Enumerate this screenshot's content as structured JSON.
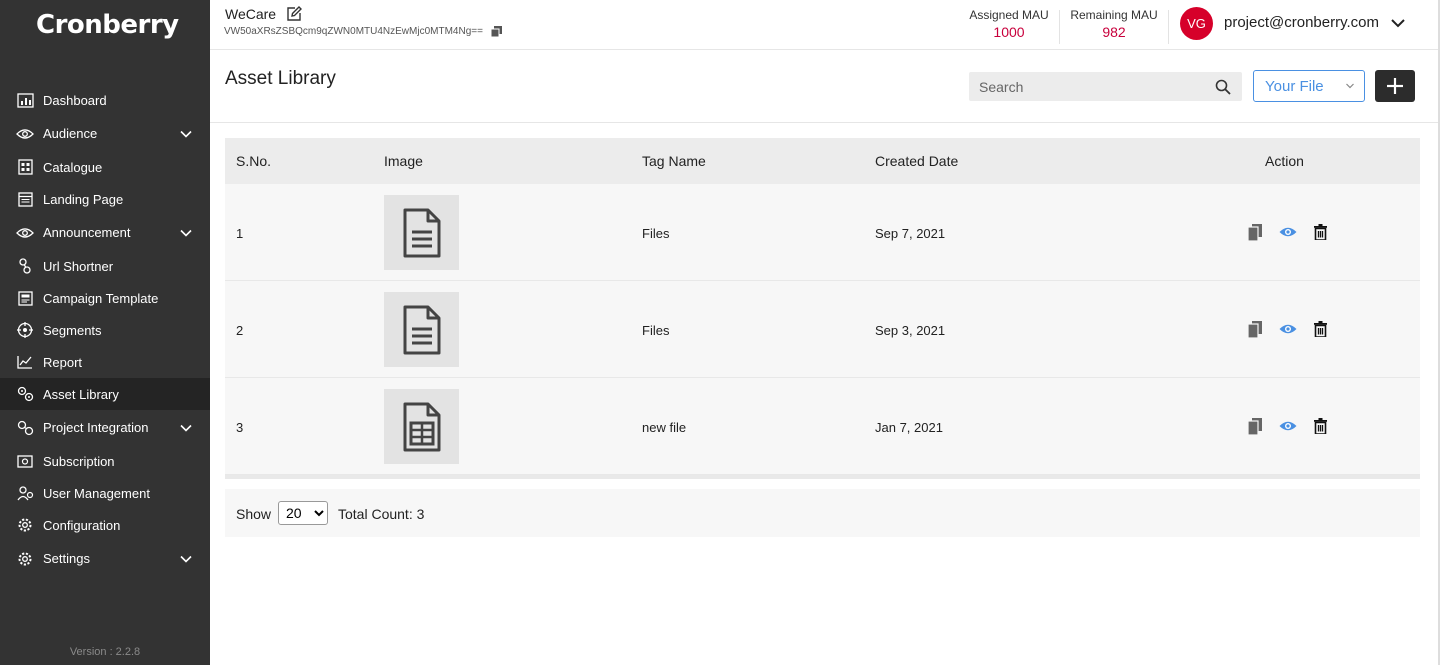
{
  "brand": {
    "logo_text": "Cronberry",
    "version": "Version : 2.2.8"
  },
  "sidebar": {
    "items": [
      {
        "label": "Dashboard",
        "icon": "dashboard-icon",
        "expandable": false
      },
      {
        "label": "Audience",
        "icon": "eye-icon",
        "expandable": true
      },
      {
        "label": "Catalogue",
        "icon": "catalogue-icon",
        "expandable": false
      },
      {
        "label": "Landing Page",
        "icon": "landing-page-icon",
        "expandable": false
      },
      {
        "label": "Announcement",
        "icon": "eye-icon",
        "expandable": true
      },
      {
        "label": "Url Shortner",
        "icon": "link-icon",
        "expandable": false
      },
      {
        "label": "Campaign Template",
        "icon": "template-icon",
        "expandable": false
      },
      {
        "label": "Segments",
        "icon": "segments-icon",
        "expandable": false
      },
      {
        "label": "Report",
        "icon": "report-icon",
        "expandable": false
      },
      {
        "label": "Asset Library",
        "icon": "asset-library-icon",
        "expandable": false,
        "active": true
      },
      {
        "label": "Project Integration",
        "icon": "integration-icon",
        "expandable": true
      },
      {
        "label": "Subscription",
        "icon": "subscription-icon",
        "expandable": false
      },
      {
        "label": "User Management",
        "icon": "user-management-icon",
        "expandable": false
      },
      {
        "label": "Configuration",
        "icon": "gear-icon",
        "expandable": false
      },
      {
        "label": "Settings",
        "icon": "gear-icon",
        "expandable": true
      }
    ]
  },
  "header": {
    "project_name": "WeCare",
    "project_key": "VW50aXRsZSBQcm9qZWN0MTU4NzEwMjc0MTM4Ng==",
    "assigned_mau_label": "Assigned MAU",
    "assigned_mau_value": "1000",
    "remaining_mau_label": "Remaining MAU",
    "remaining_mau_value": "982",
    "avatar_initials": "VG",
    "user_email": "project@cronberry.com"
  },
  "page": {
    "title": "Asset Library",
    "search_placeholder": "Search",
    "filter_value": "Your File"
  },
  "table": {
    "columns": {
      "sno": "S.No.",
      "image": "Image",
      "tag": "Tag Name",
      "date": "Created Date",
      "action": "Action"
    },
    "rows": [
      {
        "sno": "1",
        "tag": "Files",
        "date": "Sep 7, 2021",
        "thumb_icon": "document-icon"
      },
      {
        "sno": "2",
        "tag": "Files",
        "date": "Sep 3, 2021",
        "thumb_icon": "document-icon"
      },
      {
        "sno": "3",
        "tag": "new file",
        "date": "Jan 7, 2021",
        "thumb_icon": "spreadsheet-icon"
      }
    ]
  },
  "pager": {
    "show_label": "Show",
    "page_size": "20",
    "page_size_options": [
      "20"
    ],
    "total_label": "Total Count: 3"
  },
  "colors": {
    "sidebar_bg": "#333333",
    "accent_red": "#c8003c",
    "accent_blue": "#4a90e2",
    "avatar_bg": "#d6002a"
  }
}
